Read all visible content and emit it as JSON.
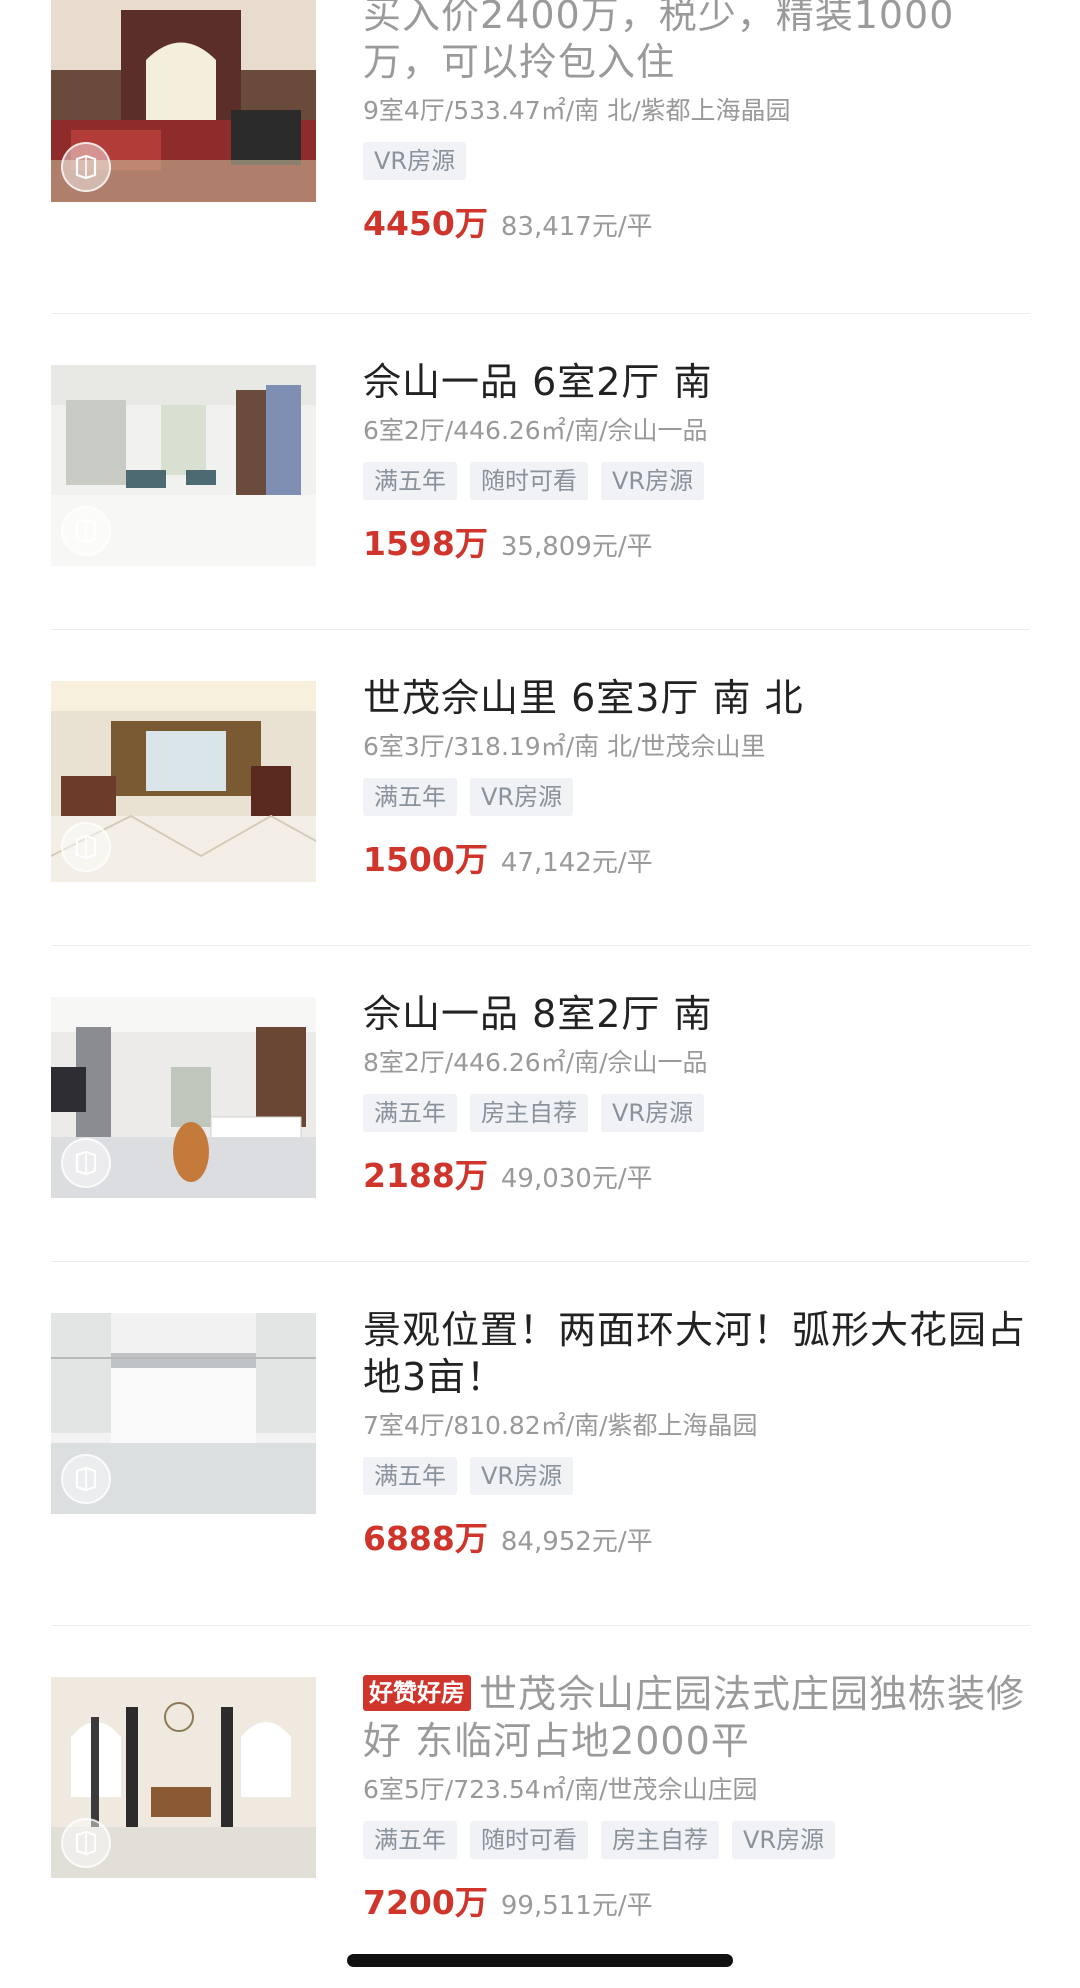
{
  "listings": [
    {
      "title": "买入价2400万，税少，精装1000万，可以拎包入住",
      "title_muted": true,
      "hot_tag": "",
      "meta": "9室4厅/533.47㎡/南 北/紫都上海晶园",
      "tags": [
        "VR房源"
      ],
      "price": "4450万",
      "unit_price": "83,417元/平",
      "vr_icon": "vr-cube-icon"
    },
    {
      "title": "佘山一品 6室2厅 南",
      "title_muted": false,
      "hot_tag": "",
      "meta": "6室2厅/446.26㎡/南/佘山一品",
      "tags": [
        "满五年",
        "随时可看",
        "VR房源"
      ],
      "price": "1598万",
      "unit_price": "35,809元/平",
      "vr_icon": "vr-cube-icon"
    },
    {
      "title": "世茂佘山里 6室3厅 南 北",
      "title_muted": false,
      "hot_tag": "",
      "meta": "6室3厅/318.19㎡/南 北/世茂佘山里",
      "tags": [
        "满五年",
        "VR房源"
      ],
      "price": "1500万",
      "unit_price": "47,142元/平",
      "vr_icon": "vr-cube-icon"
    },
    {
      "title": "佘山一品 8室2厅 南",
      "title_muted": false,
      "hot_tag": "",
      "meta": "8室2厅/446.26㎡/南/佘山一品",
      "tags": [
        "满五年",
        "房主自荐",
        "VR房源"
      ],
      "price": "2188万",
      "unit_price": "49,030元/平",
      "vr_icon": "vr-cube-icon"
    },
    {
      "title": "景观位置！两面环大河！弧形大花园占地3亩！",
      "title_muted": false,
      "hot_tag": "",
      "meta": "7室4厅/810.82㎡/南/紫都上海晶园",
      "tags": [
        "满五年",
        "VR房源"
      ],
      "price": "6888万",
      "unit_price": "84,952元/平",
      "vr_icon": "vr-cube-icon"
    },
    {
      "title": "世茂佘山庄园法式庄园独栋装修好 东临河占地2000平",
      "title_muted": true,
      "hot_tag": "好赞好房",
      "meta": "6室5厅/723.54㎡/南/世茂佘山庄园",
      "tags": [
        "满五年",
        "随时可看",
        "房主自荐",
        "VR房源"
      ],
      "price": "7200万",
      "unit_price": "99,511元/平",
      "vr_icon": "vr-cube-icon"
    }
  ],
  "colors": {
    "price": "#d0352c",
    "tag_bg": "#f0f2f5",
    "tag_text": "#8a929c",
    "meta_text": "#999999",
    "hot_tag_bg": "#d0352c"
  }
}
